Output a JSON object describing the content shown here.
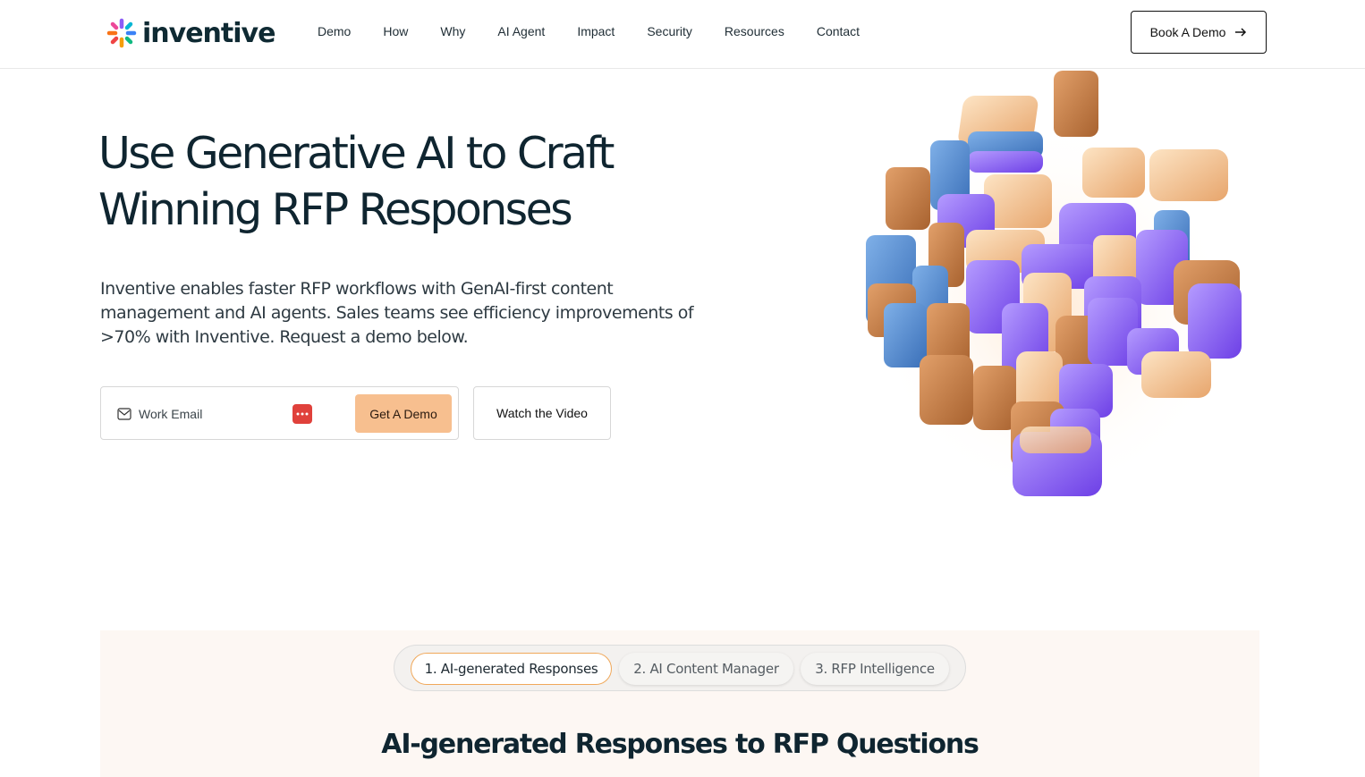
{
  "header": {
    "logo_text": "inventive",
    "nav": [
      "Demo",
      "How",
      "Why",
      "AI Agent",
      "Impact",
      "Security",
      "Resources",
      "Contact"
    ],
    "book_demo_label": "Book A Demo"
  },
  "hero": {
    "title_line1": "Use Generative AI to Craft",
    "title_line2": "Winning RFP Responses",
    "subtitle": "Inventive enables faster RFP workflows with GenAI-first content management and AI agents. Sales teams see efficiency improvements of >70% with Inventive. Request a demo below.",
    "email_placeholder": "Work Email",
    "get_demo_label": "Get A Demo",
    "watch_video_label": "Watch the Video"
  },
  "section": {
    "tabs": [
      {
        "label": "1. AI-generated Responses",
        "active": true
      },
      {
        "label": "2. AI Content Manager",
        "active": false
      },
      {
        "label": "3. RFP Intelligence",
        "active": false
      }
    ],
    "title": "AI-generated Responses to RFP Questions"
  },
  "colors": {
    "accent_peach": "#f7bf8f",
    "active_tab_border": "#f0a85a",
    "text_dark": "#0f2530",
    "section_bg": "#fdf7f3"
  },
  "icons": {
    "logo": "asterisk-logo-icon",
    "button_arrow": "arrow-right-icon",
    "email": "mail-icon",
    "password_manager": "password-manager-icon",
    "hero_image": "cube-illustration"
  }
}
